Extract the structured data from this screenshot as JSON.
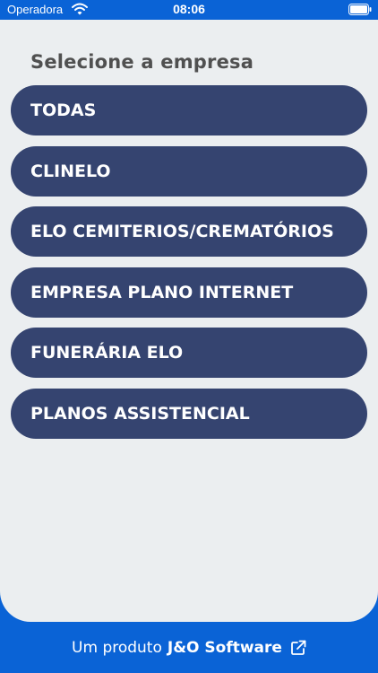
{
  "status_bar": {
    "carrier": "Operadora",
    "time": "08:06",
    "wifi_icon": "wifi-icon",
    "battery_icon": "battery-icon"
  },
  "main": {
    "title": "Selecione a empresa",
    "companies": [
      {
        "label": "TODAS"
      },
      {
        "label": "CLINELO"
      },
      {
        "label": "ELO CEMITERIOS/CREMATÓRIOS"
      },
      {
        "label": "EMPRESA PLANO INTERNET"
      },
      {
        "label": "FUNERÁRIA ELO"
      },
      {
        "label": "PLANOS ASSISTENCIAL"
      }
    ]
  },
  "footer": {
    "prefix": "Um produto",
    "brand": "J&O Software",
    "link_icon": "external-link-icon"
  },
  "colors": {
    "primary_blue": "#0a63d6",
    "button_navy": "#354470",
    "background": "#ebeef0",
    "title_gray": "#505050"
  }
}
